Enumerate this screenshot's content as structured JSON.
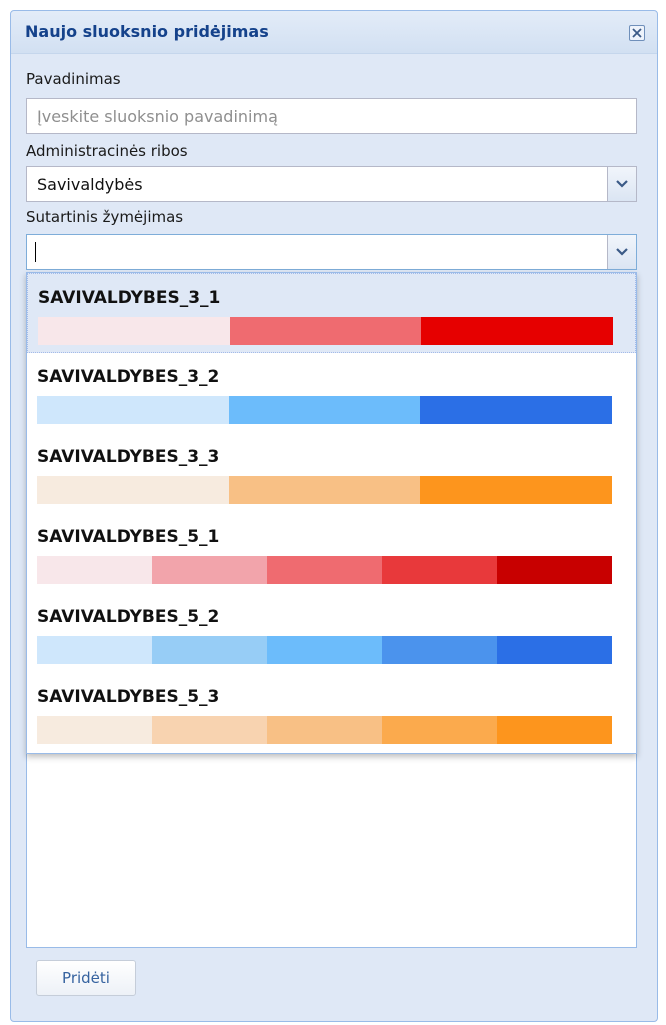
{
  "window": {
    "title": "Naujo sluoksnio pridėjimas"
  },
  "form": {
    "name_label": "Pavadinimas",
    "name_placeholder": "Įveskite sluoksnio pavadinimą",
    "admin_label": "Administracinės ribos",
    "admin_value": "Savivaldybės",
    "legend_label": "Sutartinis žymėjimas",
    "legend_value": ""
  },
  "dropdown": {
    "options": [
      {
        "label": "SAVIVALDYBES_3_1",
        "colors": [
          "#f8e7ea",
          "#ef6b70",
          "#e60000"
        ]
      },
      {
        "label": "SAVIVALDYBES_3_2",
        "colors": [
          "#cfe7fc",
          "#6cbcfb",
          "#2b6fe6"
        ]
      },
      {
        "label": "SAVIVALDYBES_3_3",
        "colors": [
          "#f7ebdf",
          "#f8c085",
          "#fd951d"
        ]
      },
      {
        "label": "SAVIVALDYBES_5_1",
        "colors": [
          "#f8e7ea",
          "#f2a4ab",
          "#ef6b70",
          "#e8393b",
          "#c80000"
        ]
      },
      {
        "label": "SAVIVALDYBES_5_2",
        "colors": [
          "#cfe7fc",
          "#97cdf6",
          "#6cbcfb",
          "#4b93ed",
          "#2b6fe6"
        ]
      },
      {
        "label": "SAVIVALDYBES_5_3",
        "colors": [
          "#f7ebdf",
          "#f8d3b0",
          "#f8c085",
          "#fbaa4d",
          "#fd951d"
        ]
      }
    ],
    "selected_index": 0
  },
  "footer": {
    "add_label": "Pridėti"
  },
  "icons": {
    "close": "close-icon",
    "dropdown": "chevron-down-icon"
  },
  "colors": {
    "title": "#15428b",
    "border": "#99bbe8",
    "window_bg": "#dfe8f6"
  }
}
